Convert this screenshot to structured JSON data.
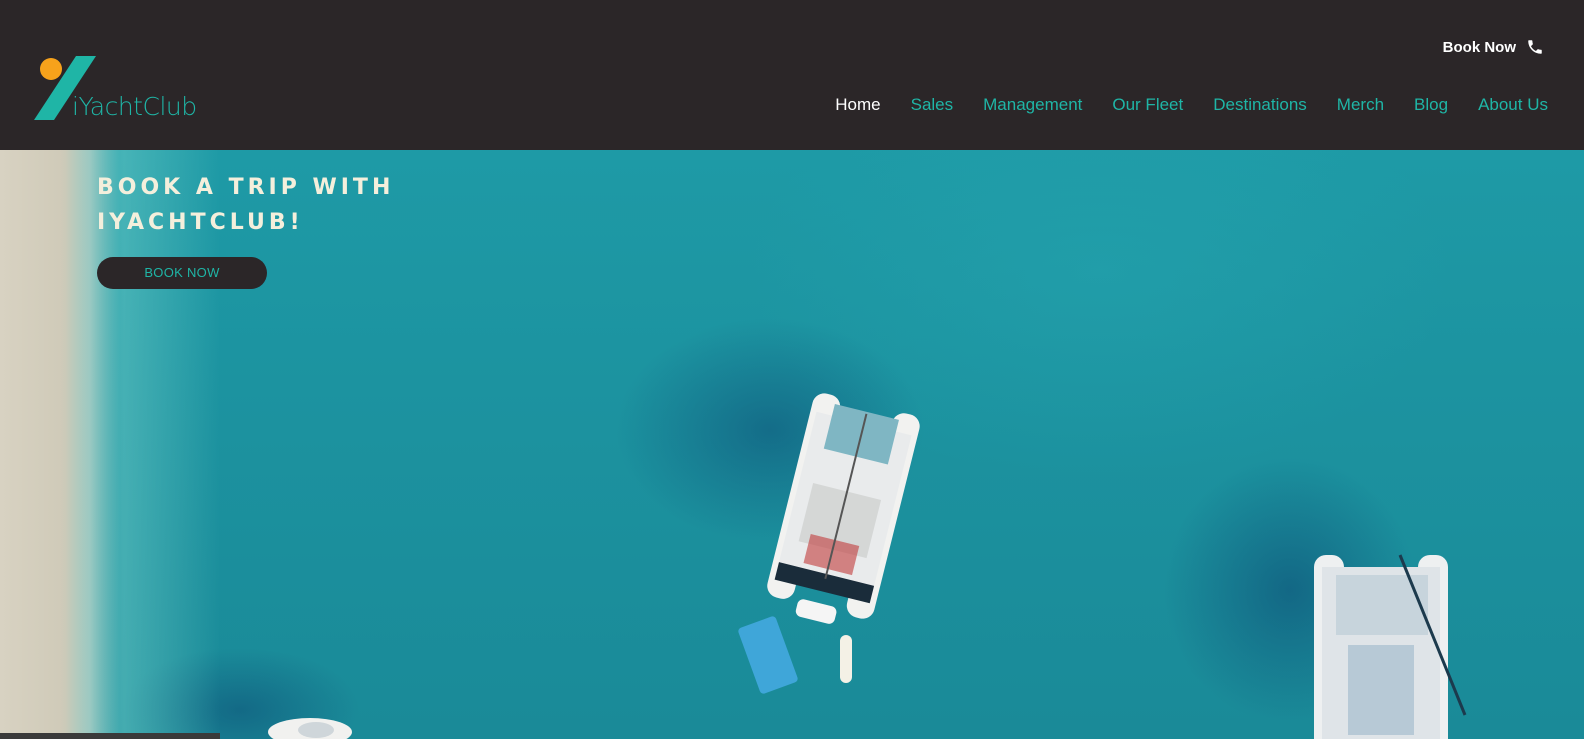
{
  "header": {
    "logo_text": "iYachtClub",
    "book_now_label": "Book Now",
    "phone_icon": "phone-icon"
  },
  "nav": {
    "items": [
      {
        "label": "Home",
        "active": true
      },
      {
        "label": "Sales"
      },
      {
        "label": "Management"
      },
      {
        "label": "Our Fleet"
      },
      {
        "label": "Destinations"
      },
      {
        "label": "Merch"
      },
      {
        "label": "Blog"
      },
      {
        "label": "About Us"
      }
    ]
  },
  "hero": {
    "title": "BOOK A TRIP WITH IYACHTCLUB!",
    "button_label": "BOOK NOW"
  },
  "colors": {
    "header_bg": "#2b2628",
    "accent_teal": "#1fb5a6",
    "logo_orange": "#f7a21b",
    "hero_title": "#f4efdc"
  }
}
